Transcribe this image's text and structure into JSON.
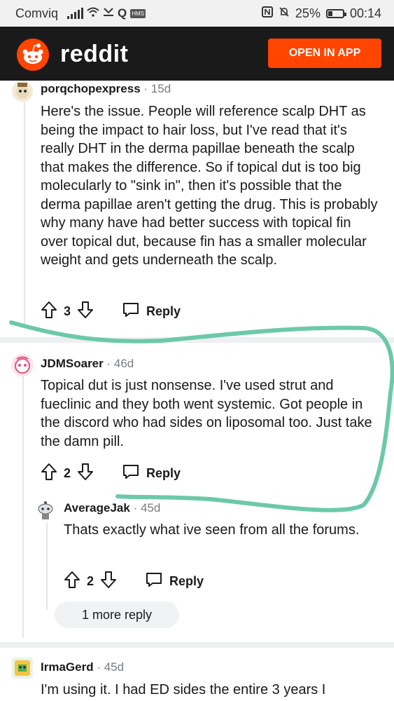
{
  "status_bar": {
    "carrier": "Comviq",
    "hms": "HMS",
    "battery": "25%",
    "time": "00:14"
  },
  "header": {
    "logo_text": "reddit",
    "open_app_label": "OPEN IN APP"
  },
  "comments": [
    {
      "author": "porqchopexpress",
      "age": "15d",
      "body": "Here's the issue. People will reference scalp DHT as being the impact to hair loss, but I've read that it's really DHT in the derma papillae beneath the scalp that makes the difference. So if topical dut is too big molecularly to \"sink in\", then it's possible that the derma papillae aren't getting the drug. This is probably why many have had better success with topical fin over topical dut, because fin has a smaller molecular weight and gets underneath the scalp.",
      "votes": "3",
      "reply_label": "Reply"
    },
    {
      "author": "JDMSoarer",
      "age": "46d",
      "body": "Topical dut is just nonsense. I've used strut and fueclinic and they both went systemic. Got people in the discord who had sides on liposomal too. Just take the damn pill.",
      "votes": "2",
      "reply_label": "Reply"
    },
    {
      "author": "AverageJak",
      "age": "45d",
      "body": "Thats exactly what ive seen from all the forums.",
      "votes": "2",
      "reply_label": "Reply"
    },
    {
      "author": "IrmaGerd",
      "age": "45d",
      "body": "I'm using it. I had ED sides the entire 3 years I"
    }
  ],
  "more_replies_label": "1 more reply",
  "colors": {
    "brand": "#ff4500",
    "header_bg": "#1a1a1b",
    "annotation_stroke": "#6cc9a8"
  }
}
